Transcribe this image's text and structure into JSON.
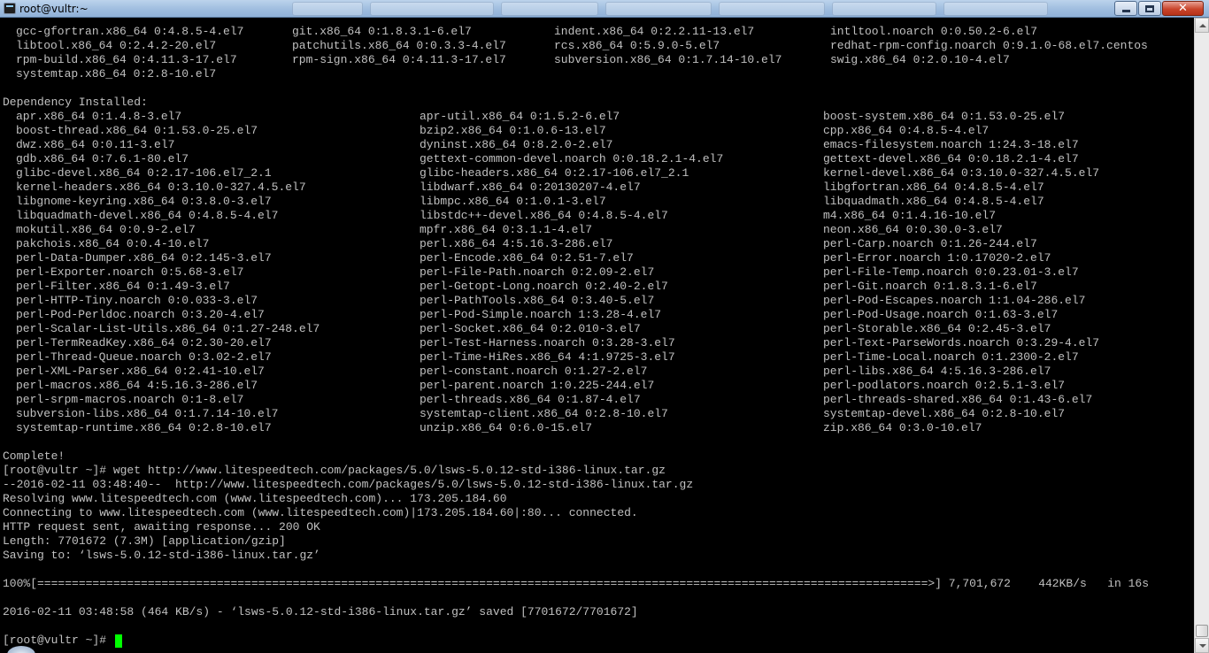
{
  "window": {
    "title": "root@vultr:~",
    "buttons": {
      "minimize": "minimize",
      "maximize": "maximize",
      "close": "close"
    }
  },
  "colors": {
    "background": "#000000",
    "text": "#c0c0c0",
    "cursor": "#00ff00"
  },
  "terminal": {
    "installed_rows": [
      [
        "gcc-gfortran.x86_64 0:4.8.5-4.el7",
        "git.x86_64 0:1.8.3.1-6.el7",
        "indent.x86_64 0:2.2.11-13.el7",
        "intltool.noarch 0:0.50.2-6.el7"
      ],
      [
        "libtool.x86_64 0:2.4.2-20.el7",
        "patchutils.x86_64 0:0.3.3-4.el7",
        "rcs.x86_64 0:5.9.0-5.el7",
        "redhat-rpm-config.noarch 0:9.1.0-68.el7.centos"
      ],
      [
        "rpm-build.x86_64 0:4.11.3-17.el7",
        "rpm-sign.x86_64 0:4.11.3-17.el7",
        "subversion.x86_64 0:1.7.14-10.el7",
        "swig.x86_64 0:2.0.10-4.el7"
      ],
      [
        "systemtap.x86_64 0:2.8-10.el7",
        "",
        "",
        ""
      ]
    ],
    "dependency_header": "Dependency Installed:",
    "dependency_rows": [
      [
        "apr.x86_64 0:1.4.8-3.el7",
        "apr-util.x86_64 0:1.5.2-6.el7",
        "boost-system.x86_64 0:1.53.0-25.el7"
      ],
      [
        "boost-thread.x86_64 0:1.53.0-25.el7",
        "bzip2.x86_64 0:1.0.6-13.el7",
        "cpp.x86_64 0:4.8.5-4.el7"
      ],
      [
        "dwz.x86_64 0:0.11-3.el7",
        "dyninst.x86_64 0:8.2.0-2.el7",
        "emacs-filesystem.noarch 1:24.3-18.el7"
      ],
      [
        "gdb.x86_64 0:7.6.1-80.el7",
        "gettext-common-devel.noarch 0:0.18.2.1-4.el7",
        "gettext-devel.x86_64 0:0.18.2.1-4.el7"
      ],
      [
        "glibc-devel.x86_64 0:2.17-106.el7_2.1",
        "glibc-headers.x86_64 0:2.17-106.el7_2.1",
        "kernel-devel.x86_64 0:3.10.0-327.4.5.el7"
      ],
      [
        "kernel-headers.x86_64 0:3.10.0-327.4.5.el7",
        "libdwarf.x86_64 0:20130207-4.el7",
        "libgfortran.x86_64 0:4.8.5-4.el7"
      ],
      [
        "libgnome-keyring.x86_64 0:3.8.0-3.el7",
        "libmpc.x86_64 0:1.0.1-3.el7",
        "libquadmath.x86_64 0:4.8.5-4.el7"
      ],
      [
        "libquadmath-devel.x86_64 0:4.8.5-4.el7",
        "libstdc++-devel.x86_64 0:4.8.5-4.el7",
        "m4.x86_64 0:1.4.16-10.el7"
      ],
      [
        "mokutil.x86_64 0:0.9-2.el7",
        "mpfr.x86_64 0:3.1.1-4.el7",
        "neon.x86_64 0:0.30.0-3.el7"
      ],
      [
        "pakchois.x86_64 0:0.4-10.el7",
        "perl.x86_64 4:5.16.3-286.el7",
        "perl-Carp.noarch 0:1.26-244.el7"
      ],
      [
        "perl-Data-Dumper.x86_64 0:2.145-3.el7",
        "perl-Encode.x86_64 0:2.51-7.el7",
        "perl-Error.noarch 1:0.17020-2.el7"
      ],
      [
        "perl-Exporter.noarch 0:5.68-3.el7",
        "perl-File-Path.noarch 0:2.09-2.el7",
        "perl-File-Temp.noarch 0:0.23.01-3.el7"
      ],
      [
        "perl-Filter.x86_64 0:1.49-3.el7",
        "perl-Getopt-Long.noarch 0:2.40-2.el7",
        "perl-Git.noarch 0:1.8.3.1-6.el7"
      ],
      [
        "perl-HTTP-Tiny.noarch 0:0.033-3.el7",
        "perl-PathTools.x86_64 0:3.40-5.el7",
        "perl-Pod-Escapes.noarch 1:1.04-286.el7"
      ],
      [
        "perl-Pod-Perldoc.noarch 0:3.20-4.el7",
        "perl-Pod-Simple.noarch 1:3.28-4.el7",
        "perl-Pod-Usage.noarch 0:1.63-3.el7"
      ],
      [
        "perl-Scalar-List-Utils.x86_64 0:1.27-248.el7",
        "perl-Socket.x86_64 0:2.010-3.el7",
        "perl-Storable.x86_64 0:2.45-3.el7"
      ],
      [
        "perl-TermReadKey.x86_64 0:2.30-20.el7",
        "perl-Test-Harness.noarch 0:3.28-3.el7",
        "perl-Text-ParseWords.noarch 0:3.29-4.el7"
      ],
      [
        "perl-Thread-Queue.noarch 0:3.02-2.el7",
        "perl-Time-HiRes.x86_64 4:1.9725-3.el7",
        "perl-Time-Local.noarch 0:1.2300-2.el7"
      ],
      [
        "perl-XML-Parser.x86_64 0:2.41-10.el7",
        "perl-constant.noarch 0:1.27-2.el7",
        "perl-libs.x86_64 4:5.16.3-286.el7"
      ],
      [
        "perl-macros.x86_64 4:5.16.3-286.el7",
        "perl-parent.noarch 1:0.225-244.el7",
        "perl-podlators.noarch 0:2.5.1-3.el7"
      ],
      [
        "perl-srpm-macros.noarch 0:1-8.el7",
        "perl-threads.x86_64 0:1.87-4.el7",
        "perl-threads-shared.x86_64 0:1.43-6.el7"
      ],
      [
        "subversion-libs.x86_64 0:1.7.14-10.el7",
        "systemtap-client.x86_64 0:2.8-10.el7",
        "systemtap-devel.x86_64 0:2.8-10.el7"
      ],
      [
        "systemtap-runtime.x86_64 0:2.8-10.el7",
        "unzip.x86_64 0:6.0-15.el7",
        "zip.x86_64 0:3.0-10.el7"
      ]
    ],
    "output_lines": [
      "Complete!",
      "[root@vultr ~]# wget http://www.litespeedtech.com/packages/5.0/lsws-5.0.12-std-i386-linux.tar.gz",
      "--2016-02-11 03:48:40--  http://www.litespeedtech.com/packages/5.0/lsws-5.0.12-std-i386-linux.tar.gz",
      "Resolving www.litespeedtech.com (www.litespeedtech.com)... 173.205.184.60",
      "Connecting to www.litespeedtech.com (www.litespeedtech.com)|173.205.184.60|:80... connected.",
      "HTTP request sent, awaiting response... 200 OK",
      "Length: 7701672 (7.3M) [application/gzip]",
      "Saving to: ‘lsws-5.0.12-std-i386-linux.tar.gz’",
      "",
      "100%[=================================================================================================================================>] 7,701,672    442KB/s   in 16s",
      "",
      "2016-02-11 03:48:58 (464 KB/s) - ‘lsws-5.0.12-std-i386-linux.tar.gz’ saved [7701672/7701672]",
      "",
      "[root@vultr ~]# "
    ],
    "download_progress_percent": 100
  }
}
